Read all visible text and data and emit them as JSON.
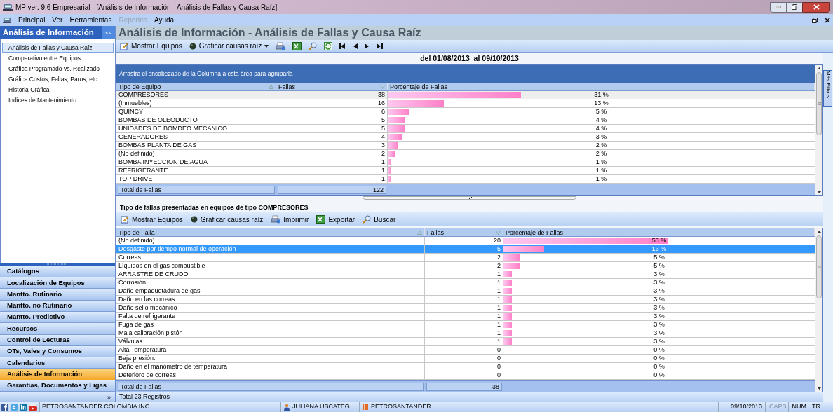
{
  "window": {
    "title": "MP ver. 9.6 Empresarial - [Análisis de Información - Análisis de Fallas y Causa Raíz]"
  },
  "menu": [
    {
      "label": "Principal",
      "disabled": false
    },
    {
      "label": "Ver",
      "disabled": false
    },
    {
      "label": "Herramientas",
      "disabled": false
    },
    {
      "label": "Reportes",
      "disabled": true
    },
    {
      "label": "Ayuda",
      "disabled": false
    }
  ],
  "sidebar": {
    "title": "Análisis de Información",
    "collapse": "<<",
    "items": [
      {
        "label": "Análisis de Fallas y Causa Raíz",
        "selected": true
      },
      {
        "label": "Comparativo entre Equipos",
        "selected": false
      },
      {
        "label": "Gráfica Programado vs. Realizado",
        "selected": false
      },
      {
        "label": "Gráfica Costos, Fallas, Paros, etc.",
        "selected": false
      },
      {
        "label": "Historia Gráfica",
        "selected": false
      },
      {
        "label": "Índices de Mantenimiento",
        "selected": false
      }
    ],
    "modules": [
      {
        "label": "Catálogos",
        "selected": false
      },
      {
        "label": "Localización de Equipos",
        "selected": false
      },
      {
        "label": "Mantto. Rutinario",
        "selected": false
      },
      {
        "label": "Mantto. no Rutinario",
        "selected": false
      },
      {
        "label": "Mantto. Predictivo",
        "selected": false
      },
      {
        "label": "Recursos",
        "selected": false
      },
      {
        "label": "Control de Lecturas",
        "selected": false
      },
      {
        "label": "OTs, Vales y Consumos",
        "selected": false
      },
      {
        "label": "Calendarios",
        "selected": false
      },
      {
        "label": "Análisis de Información",
        "selected": true
      },
      {
        "label": "Garantías, Documentos y Ligas",
        "selected": false
      }
    ],
    "more": "»"
  },
  "page_title": "Análisis de Información - Análisis de Fallas y Causa Raíz",
  "toolbar": [
    {
      "kind": "edit",
      "label": "Mostrar Equipos"
    },
    {
      "kind": "chart",
      "label": "Graficar causas raíz",
      "dropdown": true
    },
    {
      "kind": "print"
    },
    {
      "kind": "excel"
    },
    {
      "kind": "find"
    },
    {
      "kind": "refresh"
    },
    {
      "kind": "first"
    },
    {
      "kind": "prev"
    },
    {
      "kind": "next"
    },
    {
      "kind": "last"
    }
  ],
  "date_range": "del 01/08/2013  al 09/10/2013",
  "side_tab": "Más Filtros...",
  "equipment_grid": {
    "group_hint": "Arrastra el encabezado de la Columna a esta área para agruparla",
    "columns": [
      "Tipo de Equipo",
      "Fallas",
      "Porcentaje de Fallas"
    ],
    "rows": [
      {
        "type": "COMPRESORES",
        "fallas": "38",
        "pct": "31 %",
        "selected": true
      },
      {
        "type": "(Inmuebles)",
        "fallas": "16",
        "pct": "13 %",
        "selected": false
      },
      {
        "type": "QUINCY",
        "fallas": "6",
        "pct": "5 %",
        "selected": false
      },
      {
        "type": "BOMBAS DE OLEODUCTO",
        "fallas": "5",
        "pct": "4 %",
        "selected": false
      },
      {
        "type": "UNIDADES DE BOMDEO MECÁNICO",
        "fallas": "5",
        "pct": "4 %",
        "selected": false
      },
      {
        "type": "GENERADORES",
        "fallas": "4",
        "pct": "3 %",
        "selected": false
      },
      {
        "type": "BOMBAS PLANTA DE GAS",
        "fallas": "3",
        "pct": "2 %",
        "selected": false
      },
      {
        "type": "(No definido)",
        "fallas": "2",
        "pct": "2 %",
        "selected": false
      },
      {
        "type": "BOMBA INYECCION DE AGUA",
        "fallas": "1",
        "pct": "1 %",
        "selected": false
      },
      {
        "type": "REFRIGERANTE",
        "fallas": "1",
        "pct": "1 %",
        "selected": false
      },
      {
        "type": "TOP DRIVE",
        "fallas": "1",
        "pct": "1 %",
        "selected": false
      }
    ],
    "total_label": "Total de Fallas",
    "total": "122"
  },
  "detail_title": "Tipo de fallas presentadas en equipos de tipo COMPRESORES",
  "detail_toolbar": [
    {
      "kind": "edit",
      "label": "Mostrar Equipos"
    },
    {
      "kind": "chart",
      "label": "Graficar causas raíz"
    },
    {
      "kind": "print",
      "label": "Imprimir"
    },
    {
      "kind": "excel",
      "label": "Exportar"
    },
    {
      "kind": "find",
      "label": "Buscar"
    }
  ],
  "failure_grid": {
    "columns": [
      "Tipo de Falla",
      "Fallas",
      "Porcentaje de Fallas"
    ],
    "rows": [
      {
        "type": "(No definido)",
        "fallas": "20",
        "pct": "53 %",
        "selected": false
      },
      {
        "type": "Desgaste por tiempo normal de operación",
        "fallas": "5",
        "pct": "13 %",
        "selected": true
      },
      {
        "type": "Correas",
        "fallas": "2",
        "pct": "5 %",
        "selected": false
      },
      {
        "type": "Líquidos en el gas combustible",
        "fallas": "2",
        "pct": "5 %",
        "selected": false
      },
      {
        "type": "ARRASTRE DE CRUDO",
        "fallas": "1",
        "pct": "3 %",
        "selected": false
      },
      {
        "type": "Corrosión",
        "fallas": "1",
        "pct": "3 %",
        "selected": false
      },
      {
        "type": "Daño empaquetadura de gas",
        "fallas": "1",
        "pct": "3 %",
        "selected": false
      },
      {
        "type": "Daño en las correas",
        "fallas": "1",
        "pct": "3 %",
        "selected": false
      },
      {
        "type": "Daño sello mecánico",
        "fallas": "1",
        "pct": "3 %",
        "selected": false
      },
      {
        "type": "Falta de refrigerante",
        "fallas": "1",
        "pct": "3 %",
        "selected": false
      },
      {
        "type": "Fuga de gas",
        "fallas": "1",
        "pct": "3 %",
        "selected": false
      },
      {
        "type": "Mala calibración pistón",
        "fallas": "1",
        "pct": "3 %",
        "selected": false
      },
      {
        "type": "Válvulas",
        "fallas": "1",
        "pct": "3 %",
        "selected": false
      },
      {
        "type": "Alta Temperatura",
        "fallas": "0",
        "pct": "0 %",
        "selected": false
      },
      {
        "type": "Baja presión.",
        "fallas": "0",
        "pct": "0 %",
        "selected": false
      },
      {
        "type": "Daño en el manómetro de temperatura",
        "fallas": "0",
        "pct": "0 %",
        "selected": false
      },
      {
        "type": "Deterioro de correas",
        "fallas": "0",
        "pct": "0 %",
        "selected": false
      }
    ],
    "total_label": "Total de Fallas",
    "total": "38",
    "records": "Total 23 Registros"
  },
  "status_bar": {
    "company": "PETROSANTANDER COLOMBIA INC",
    "user": "JULIANA USCATEG...",
    "database": "PETROSANTANDER",
    "date": "09/10/2013",
    "keys": [
      {
        "label": "CAPS",
        "on": false
      },
      {
        "label": "NUM",
        "on": true
      },
      {
        "label": "TR",
        "on": true
      }
    ]
  }
}
